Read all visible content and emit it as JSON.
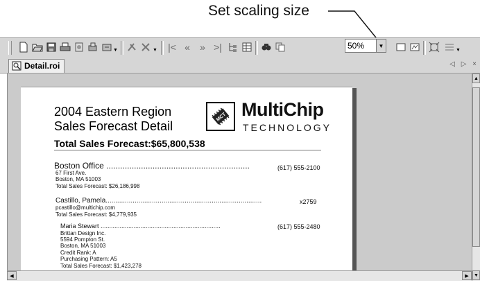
{
  "annotation": {
    "label": "Set scaling size"
  },
  "toolbar": {
    "zoom_value": "50%",
    "icons": [
      "new-file-icon",
      "open-folder-icon",
      "save-icon",
      "print-icon",
      "print-preview-icon",
      "print-setup-icon",
      "export-icon",
      "design-tool-icon",
      "tools-icon",
      "first-page-icon",
      "previous-page-icon",
      "next-page-icon",
      "last-page-icon",
      "tree-icon",
      "table-icon",
      "find-icon",
      "copy-icon",
      "single-page-icon",
      "scaling-icon",
      "fit-page-icon",
      "page-menu-icon"
    ]
  },
  "tab": {
    "label": "Detail.roi",
    "nav": "◁ ▷ ×"
  },
  "report": {
    "title_line1": "2004 Eastern Region",
    "title_line2": "Sales Forecast Detail",
    "total": "Total Sales Forecast:$65,800,538",
    "logo_name": "MultiChip",
    "logo_sub": "TECHNOLOGY",
    "logo_badge": "MCT",
    "office": {
      "name": "Boston  Office",
      "phone": "(617) 555-2100",
      "lines": [
        "67 First Ave.",
        "Boston, MA  51003",
        "Total Sales Forecast:  $26,186,998"
      ]
    },
    "rep": {
      "name": "Castillo, Pamela",
      "ext": "x2759",
      "lines": [
        "pcastillo@multichip.com",
        "Total Sales Forecast:   $4,779,935"
      ]
    },
    "customer": {
      "name": "Maria  Stewart",
      "phone": "(617) 555-2480",
      "lines": [
        "Brittan Design Inc.",
        "5594 Pompton St.",
        "Boston, MA  51003",
        "Credit Rank:  A",
        "Purchasing Pattern:  A5",
        "Total Sales Forecast:  $1,423,278"
      ]
    }
  },
  "colors": {
    "toolbar_bg": "#d6d6d6",
    "workspace_bg": "#cbcbcb"
  }
}
